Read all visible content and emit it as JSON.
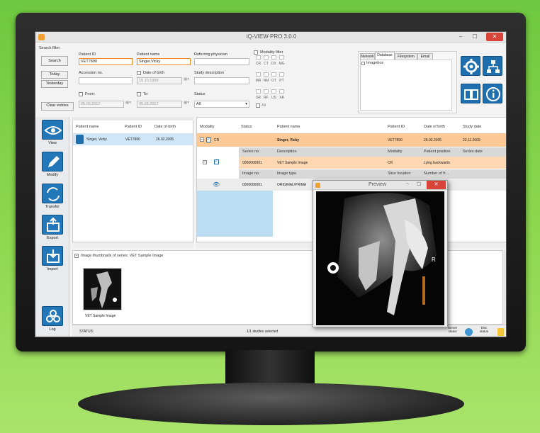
{
  "window": {
    "title": "iQ-VIEW PRO 3.0.0",
    "minimize": "–",
    "maximize": "☐",
    "close": "✕"
  },
  "search": {
    "group_label": "Search filter",
    "search_btn": "Search",
    "today_btn": "Today",
    "yesterday_btn": "Yesterday",
    "clear_btn": "Clear entries",
    "patient_id_label": "Patient ID",
    "patient_id_value": "VET7890",
    "patient_name_label": "Patient name",
    "patient_name_value": "Singer,Vicky",
    "referring_label": "Referring physician",
    "modality_filter_label": "Modality filter",
    "accession_label": "Accession no.",
    "dob_label": "Date of birth",
    "dob_value": "10.10.1999",
    "study_desc_label": "Study description",
    "from_label": "From:",
    "from_value": "05.05.2017",
    "to_label": "To:",
    "to_value": "05.05.2017",
    "status_label": "Status",
    "status_value": "All",
    "mod_row1": [
      "CR",
      "CT",
      "DX",
      "MG"
    ],
    "mod_row2": [
      "MR",
      "NM",
      "OT",
      "PT"
    ],
    "mod_row3": [
      "SR",
      "RF",
      "US",
      "XA"
    ],
    "all_label": "All"
  },
  "source_tabs": [
    "Network",
    "Database",
    "Filesystem",
    "Email"
  ],
  "imagebox_label": "Imagebox",
  "sidebar": [
    {
      "label": "View"
    },
    {
      "label": "Modify"
    },
    {
      "label": "Transfer"
    },
    {
      "label": "Export"
    },
    {
      "label": "Import"
    },
    {
      "label": "Log"
    }
  ],
  "patients": {
    "headers": [
      "Patient name",
      "Patient ID",
      "Date of birth"
    ],
    "rows": [
      [
        "Singer, Vicky",
        "VET7890",
        "26.02.2005"
      ]
    ]
  },
  "studies": {
    "headers": [
      "Modality",
      "Status",
      "Patient name",
      "Patient ID",
      "Date of birth",
      "Study date"
    ],
    "row": [
      "CR",
      "",
      "Singer, Vicky",
      "VET7890",
      "26.02.2005",
      "23.11.2009"
    ],
    "series_headers": [
      "Series no.",
      "Description",
      "Modality",
      "Patient position",
      "Series date"
    ],
    "series_row": [
      "0000000001",
      "VET Sample Image",
      "CR",
      "Lying backwards",
      ""
    ],
    "image_headers": [
      "Image no.",
      "Image type",
      "Slice location",
      "Number of fr..."
    ],
    "image_row": [
      "0000000001",
      "ORIGINAL\\PRIMA",
      "",
      ""
    ]
  },
  "thumbs": {
    "header": "Image thumbnails of series: VET Sample Image",
    "caption": "VET Sample Image"
  },
  "status": {
    "label": "STATUS:",
    "center": "1/1 studies selected",
    "server": "Server\nstatus",
    "disc": "Disc\nstatus"
  },
  "preview": {
    "title": "Preview",
    "min": "–",
    "max": "☐",
    "close": "✕",
    "marker": "R"
  },
  "colors": {
    "accent": "#f08a24",
    "tile": "#1f6fae",
    "selected_row": "#fcd2a8",
    "blue_cell": "#b9dcf4"
  }
}
